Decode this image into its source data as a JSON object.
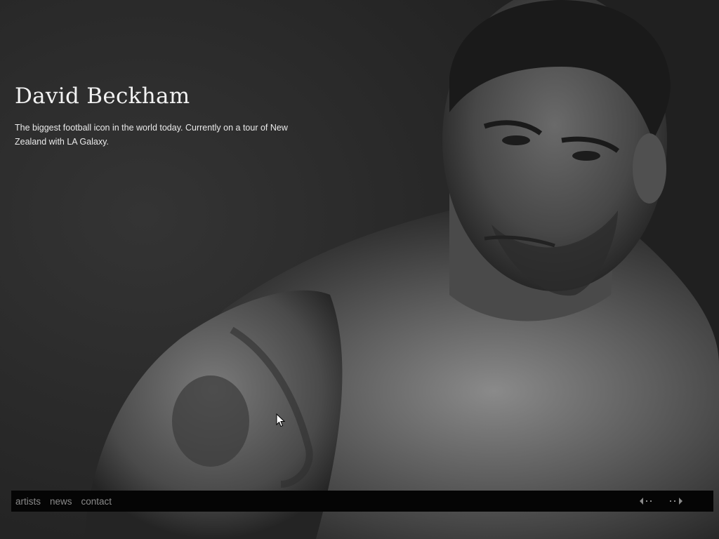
{
  "slide": {
    "title": "David Beckham",
    "description": "The biggest football icon in the world today. Currently on a tour of New Zealand with LA Galaxy."
  },
  "nav": {
    "links": [
      {
        "label": "artists"
      },
      {
        "label": "news"
      },
      {
        "label": "contact"
      }
    ],
    "prev_icon": "arrow-left-icon",
    "next_icon": "arrow-right-icon"
  },
  "colors": {
    "background": "#2a2a2a",
    "navbar": "#050505",
    "nav_text": "#8a8a8a",
    "title_text": "#f2f2f2"
  }
}
